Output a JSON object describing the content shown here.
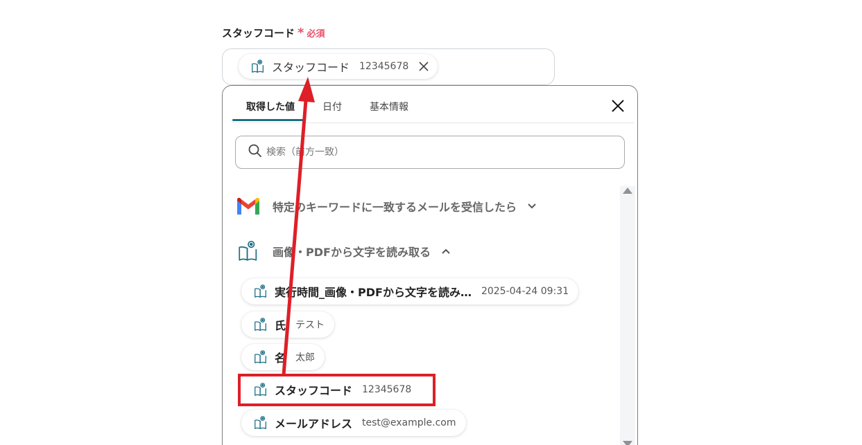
{
  "field": {
    "label": "スタッフコード",
    "required_star": "*",
    "required_text": "必須",
    "chip_name": "スタッフコード",
    "chip_value": "12345678"
  },
  "tabs": [
    {
      "label": "取得した値",
      "active": true
    },
    {
      "label": "日付",
      "active": false
    },
    {
      "label": "基本情報",
      "active": false
    }
  ],
  "search": {
    "placeholder": "検索（前方一致）"
  },
  "sections": [
    {
      "title": "特定のキーワードに一致するメールを受信したら",
      "icon": "gmail-icon",
      "expanded": false
    },
    {
      "title": "画像・PDFから文字を読み取る",
      "icon": "book-eye-icon",
      "expanded": true
    }
  ],
  "items": [
    {
      "name": "実行時間_画像・PDFから文字を読み…",
      "value": "2025-04-24 09:31"
    },
    {
      "name": "氏",
      "value": "テスト"
    },
    {
      "name": "名",
      "value": "太郎"
    },
    {
      "name": "スタッフコード",
      "value": "12345678",
      "highlighted": true
    },
    {
      "name": "メールアドレス",
      "value": "test@example.com"
    }
  ],
  "colors": {
    "accent": "#1b6e86",
    "required": "#e8506a",
    "annotation": "#de1f27",
    "icon": "#1b6e86"
  }
}
